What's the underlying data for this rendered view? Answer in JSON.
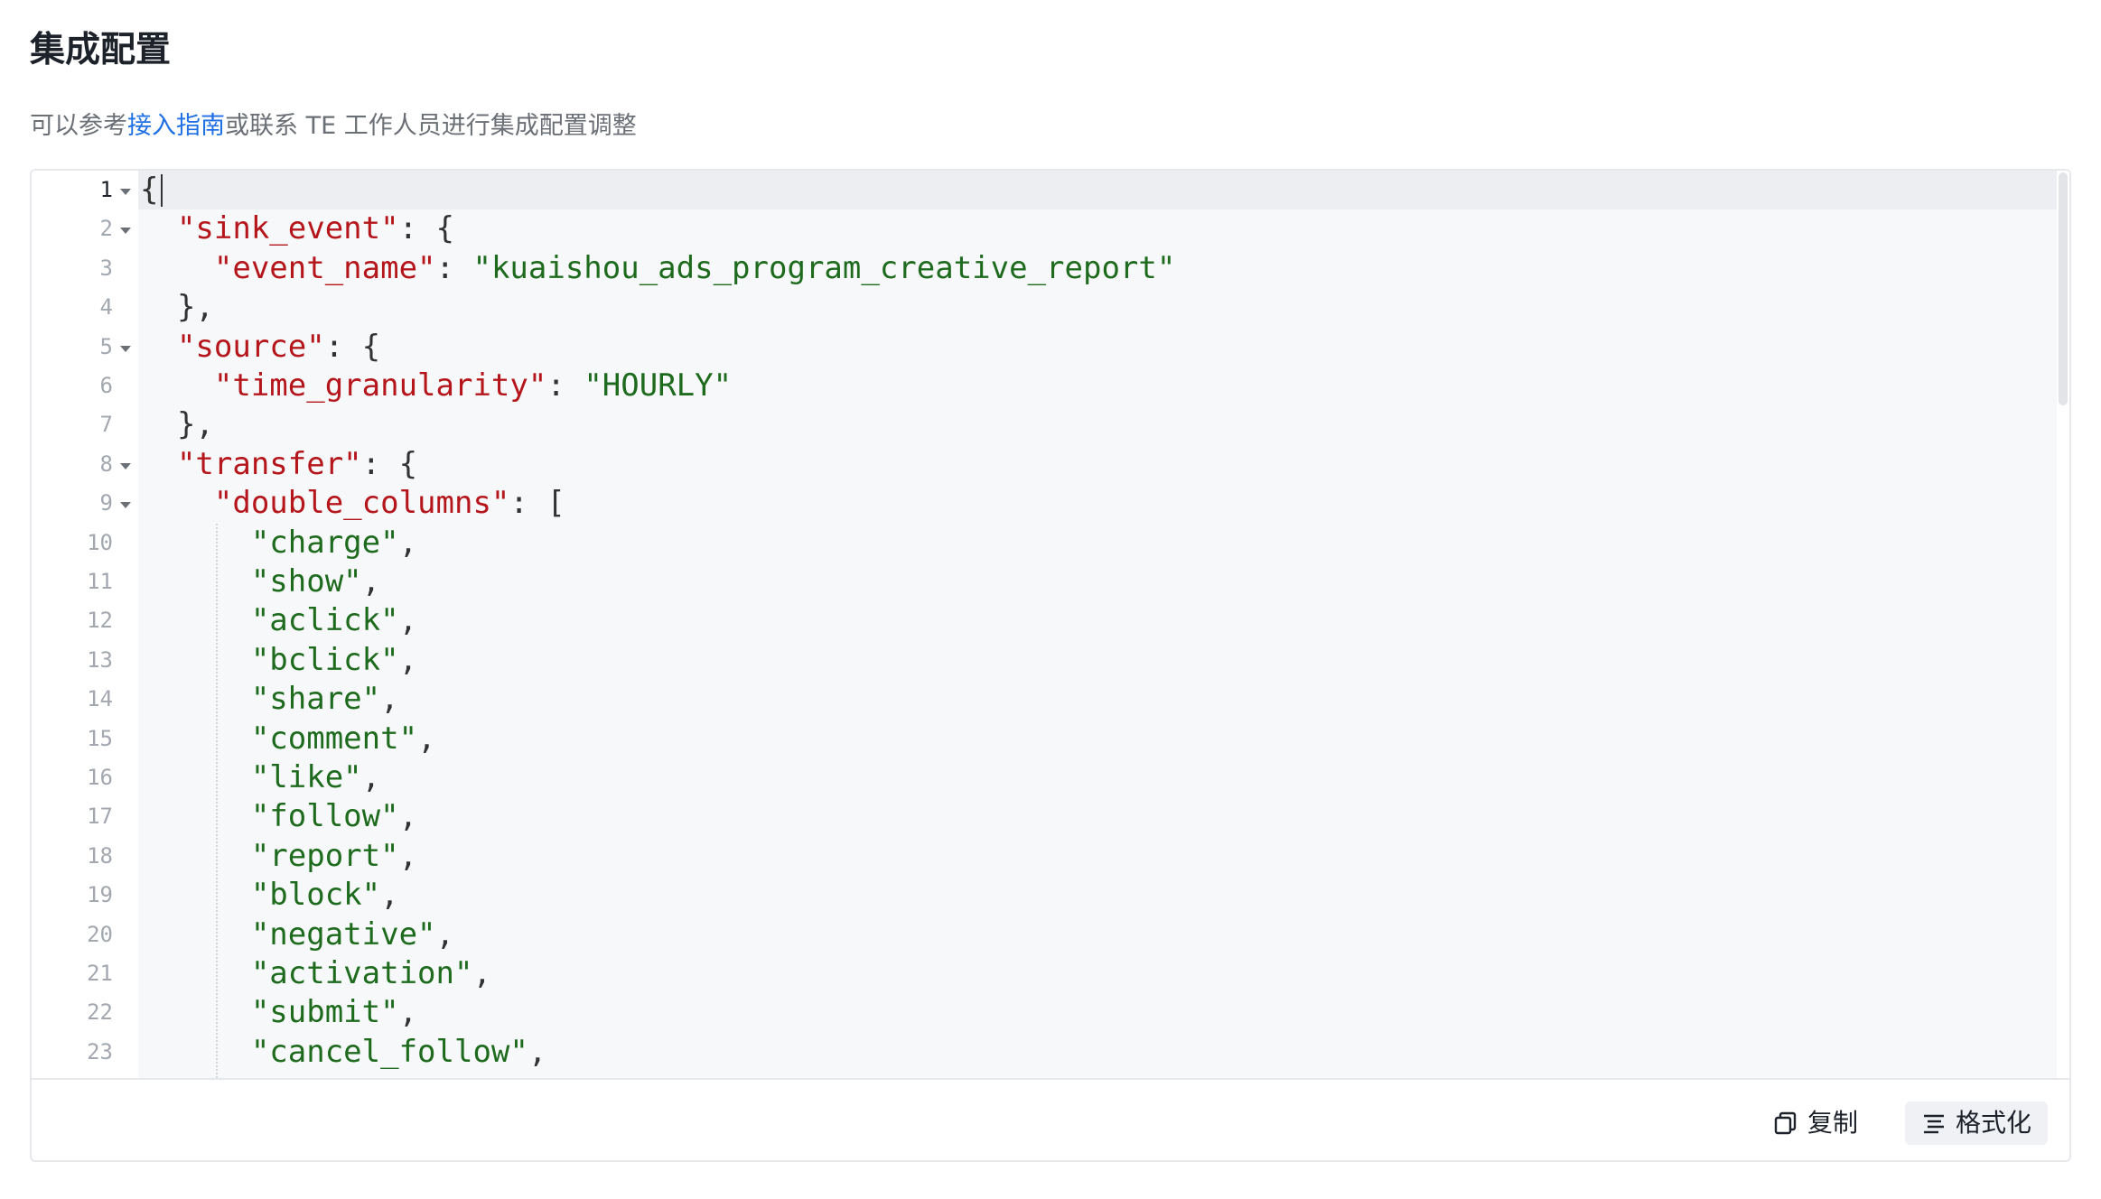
{
  "header": {
    "title": "集成配置",
    "description_prefix": "可以参考",
    "guide_link": "接入指南",
    "description_suffix": "或联系 TE 工作人员进行集成配置调整"
  },
  "editor": {
    "active_line": 1,
    "lines": [
      {
        "num": "1",
        "fold": true,
        "tokens": [
          [
            "p",
            "{"
          ]
        ]
      },
      {
        "num": "2",
        "fold": true,
        "tokens": [
          [
            "p",
            "  "
          ],
          [
            "k",
            "\"sink_event\""
          ],
          [
            "p",
            ": {"
          ]
        ]
      },
      {
        "num": "3",
        "fold": false,
        "tokens": [
          [
            "p",
            "    "
          ],
          [
            "k",
            "\"event_name\""
          ],
          [
            "p",
            ": "
          ],
          [
            "s",
            "\"kuaishou_ads_program_creative_report\""
          ]
        ]
      },
      {
        "num": "4",
        "fold": false,
        "tokens": [
          [
            "p",
            "  },"
          ]
        ]
      },
      {
        "num": "5",
        "fold": true,
        "tokens": [
          [
            "p",
            "  "
          ],
          [
            "k",
            "\"source\""
          ],
          [
            "p",
            ": {"
          ]
        ]
      },
      {
        "num": "6",
        "fold": false,
        "tokens": [
          [
            "p",
            "    "
          ],
          [
            "k",
            "\"time_granularity\""
          ],
          [
            "p",
            ": "
          ],
          [
            "s",
            "\"HOURLY\""
          ]
        ]
      },
      {
        "num": "7",
        "fold": false,
        "tokens": [
          [
            "p",
            "  },"
          ]
        ]
      },
      {
        "num": "8",
        "fold": true,
        "tokens": [
          [
            "p",
            "  "
          ],
          [
            "k",
            "\"transfer\""
          ],
          [
            "p",
            ": {"
          ]
        ]
      },
      {
        "num": "9",
        "fold": true,
        "tokens": [
          [
            "p",
            "    "
          ],
          [
            "k",
            "\"double_columns\""
          ],
          [
            "p",
            ": ["
          ]
        ]
      },
      {
        "num": "10",
        "fold": false,
        "tokens": [
          [
            "p",
            "      "
          ],
          [
            "s",
            "\"charge\""
          ],
          [
            "p",
            ","
          ]
        ]
      },
      {
        "num": "11",
        "fold": false,
        "tokens": [
          [
            "p",
            "      "
          ],
          [
            "s",
            "\"show\""
          ],
          [
            "p",
            ","
          ]
        ]
      },
      {
        "num": "12",
        "fold": false,
        "tokens": [
          [
            "p",
            "      "
          ],
          [
            "s",
            "\"aclick\""
          ],
          [
            "p",
            ","
          ]
        ]
      },
      {
        "num": "13",
        "fold": false,
        "tokens": [
          [
            "p",
            "      "
          ],
          [
            "s",
            "\"bclick\""
          ],
          [
            "p",
            ","
          ]
        ]
      },
      {
        "num": "14",
        "fold": false,
        "tokens": [
          [
            "p",
            "      "
          ],
          [
            "s",
            "\"share\""
          ],
          [
            "p",
            ","
          ]
        ]
      },
      {
        "num": "15",
        "fold": false,
        "tokens": [
          [
            "p",
            "      "
          ],
          [
            "s",
            "\"comment\""
          ],
          [
            "p",
            ","
          ]
        ]
      },
      {
        "num": "16",
        "fold": false,
        "tokens": [
          [
            "p",
            "      "
          ],
          [
            "s",
            "\"like\""
          ],
          [
            "p",
            ","
          ]
        ]
      },
      {
        "num": "17",
        "fold": false,
        "tokens": [
          [
            "p",
            "      "
          ],
          [
            "s",
            "\"follow\""
          ],
          [
            "p",
            ","
          ]
        ]
      },
      {
        "num": "18",
        "fold": false,
        "tokens": [
          [
            "p",
            "      "
          ],
          [
            "s",
            "\"report\""
          ],
          [
            "p",
            ","
          ]
        ]
      },
      {
        "num": "19",
        "fold": false,
        "tokens": [
          [
            "p",
            "      "
          ],
          [
            "s",
            "\"block\""
          ],
          [
            "p",
            ","
          ]
        ]
      },
      {
        "num": "20",
        "fold": false,
        "tokens": [
          [
            "p",
            "      "
          ],
          [
            "s",
            "\"negative\""
          ],
          [
            "p",
            ","
          ]
        ]
      },
      {
        "num": "21",
        "fold": false,
        "tokens": [
          [
            "p",
            "      "
          ],
          [
            "s",
            "\"activation\""
          ],
          [
            "p",
            ","
          ]
        ]
      },
      {
        "num": "22",
        "fold": false,
        "tokens": [
          [
            "p",
            "      "
          ],
          [
            "s",
            "\"submit\""
          ],
          [
            "p",
            ","
          ]
        ]
      },
      {
        "num": "23",
        "fold": false,
        "tokens": [
          [
            "p",
            "      "
          ],
          [
            "s",
            "\"cancel_follow\""
          ],
          [
            "p",
            ","
          ]
        ]
      }
    ]
  },
  "footer": {
    "copy_label": "复制",
    "format_label": "格式化",
    "copy_icon": "copy-icon",
    "format_icon": "align-left-icon"
  },
  "colors": {
    "key": "#b5161b",
    "string": "#1e6b1e",
    "link": "#1f6fe5",
    "code_background": "#f7f8fa"
  }
}
